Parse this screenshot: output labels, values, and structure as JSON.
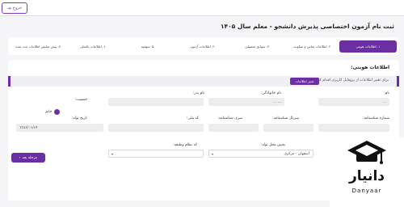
{
  "topbar": {
    "exit_label": "خروج",
    "exit_icon": "logout-icon"
  },
  "page": {
    "title": "ثبت نام آزمون اختصاصی پذیرش دانشجو - معلم سال ۱۴۰۵"
  },
  "steps": [
    "۱. اطلاعات هویتی",
    "۲. اطلاعات تماس و سکونت",
    "۳. سوابق تحصیلی",
    "۴. اطلاعات آزمون",
    "۵. سهمیه",
    "۶. اطلاعات تکمیلی",
    "۷. پیش نمایش اطلاعات ثبت شده"
  ],
  "section": {
    "title": "اطلاعات هویتی:",
    "notice_text": "برای تغییر اطلاعات از پروفایل کاربری اقدام کنید.",
    "notice_button": "تغییر اطلاعات"
  },
  "form": {
    "name_label": "نام:",
    "name_value": "...",
    "family_label": "نام خانوادگی:",
    "family_value": "... ...",
    "father_label": "نام پدر:",
    "gender_label": "جنسیت:",
    "gender_option": "خانم",
    "nid_label": "شماره شناسنامه:",
    "serial_label": "سریال شناسنامه:",
    "series_label": "سری شناسنامه:",
    "code_label": "کد ملی:",
    "birth_label": "تاریخ تولد:",
    "birth_value": "۱۳۸۶/۰۱/۱۴",
    "birthplace_label": "بخش محل تولد:",
    "birthplace_value": "اصفهان - مرکزی",
    "duty_label": "کد نظام وظیفه:",
    "hidden_label": "استا"
  },
  "actions": {
    "next_label": "مرحله بعد"
  },
  "logo": {
    "fa": "دانیار",
    "en": "Danyaar"
  },
  "colors": {
    "accent": "#6b2fa3"
  }
}
